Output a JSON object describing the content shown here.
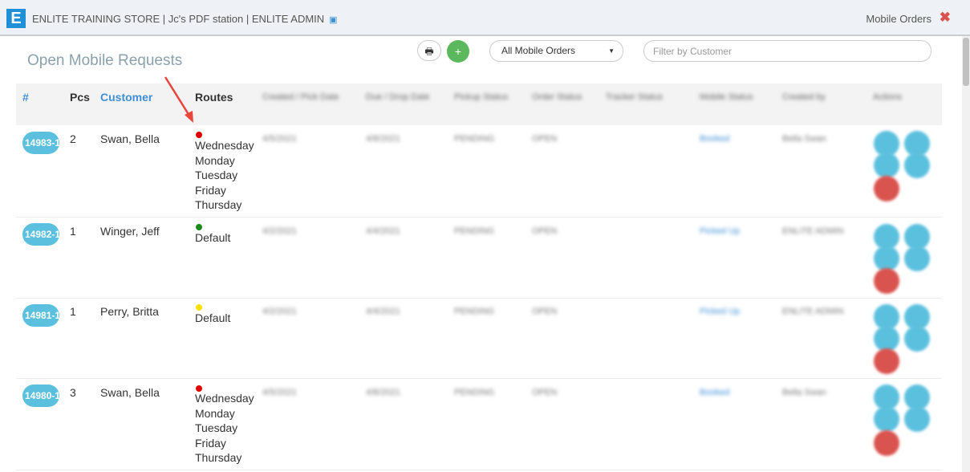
{
  "header": {
    "logo_letter": "E",
    "title": "ENLITE TRAINING STORE | Jc's PDF station | ENLITE ADMIN",
    "right_label": "Mobile Orders",
    "close_symbol": "✖"
  },
  "page": {
    "title": "Open Mobile Requests"
  },
  "toolbar": {
    "print_symbol": "🖶",
    "add_symbol": "+",
    "status_selected": "All Mobile Orders",
    "filter_placeholder": "Filter by Customer"
  },
  "table": {
    "headers": {
      "number": "#",
      "pcs": "Pcs",
      "customer": "Customer",
      "routes": "Routes",
      "created": "Created / Pick Date",
      "due": "Due / Drop Date",
      "pickup_status": "Pickup Status",
      "order_status": "Order Status",
      "tracker_status": "Tracker Status",
      "mobile_status": "Mobile Status",
      "created_by": "Created by",
      "actions": "Actions"
    },
    "rows": [
      {
        "order": "14983-1",
        "pcs": "2",
        "customer": "Swan, Bella",
        "route_color": "#e00000",
        "routes": "Wednesday\nMonday\nTuesday\nFriday\nThursday",
        "created": "4/5/2021",
        "due": "4/8/2021",
        "pickup": "PENDING",
        "order_status": "OPEN",
        "mobile_status": "Booked",
        "created_by": "Bella Swan"
      },
      {
        "order": "14982-1",
        "pcs": "1",
        "customer": "Winger, Jeff",
        "route_color": "#1a8a1a",
        "routes": "Default",
        "created": "4/2/2021",
        "due": "4/4/2021",
        "pickup": "PENDING",
        "order_status": "OPEN",
        "mobile_status": "Picked Up",
        "created_by": "ENLITE ADMIN"
      },
      {
        "order": "14981-1",
        "pcs": "1",
        "customer": "Perry, Britta",
        "route_color": "#f5e000",
        "routes": "Default",
        "created": "4/2/2021",
        "due": "4/4/2021",
        "pickup": "PENDING",
        "order_status": "OPEN",
        "mobile_status": "Picked Up",
        "created_by": "ENLITE ADMIN"
      },
      {
        "order": "14980-1",
        "pcs": "3",
        "customer": "Swan, Bella",
        "route_color": "#e00000",
        "routes": "Wednesday\nMonday\nTuesday\nFriday\nThursday",
        "created": "4/5/2021",
        "due": "4/8/2021",
        "pickup": "PENDING",
        "order_status": "OPEN",
        "mobile_status": "Booked",
        "created_by": "Bella Swan"
      }
    ]
  },
  "colors": {
    "accent": "#3d8fd6",
    "pill": "#5bc0de",
    "add_button": "#5cb85c",
    "danger": "#d9534f",
    "annotation_arrow": "#e8453c"
  },
  "icons": {
    "logo": "enlite-logo-icon",
    "title_badge": "id-card-icon",
    "close": "close-icon",
    "print": "print-icon",
    "add": "plus-icon",
    "dropdown": "chevron-down-icon",
    "view": "eye-icon",
    "edit": "edit-icon",
    "delete": "trash-icon",
    "route": "status-dot-icon"
  }
}
